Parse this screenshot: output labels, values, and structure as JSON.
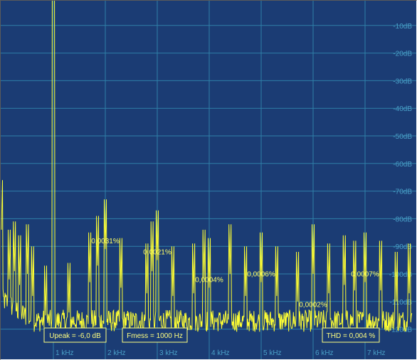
{
  "chart_data": {
    "type": "line",
    "title": "",
    "xlabel": "",
    "ylabel": "",
    "x_unit": "Hz",
    "y_unit": "dB",
    "xlim": [
      0,
      7900
    ],
    "ylim": [
      -130,
      0
    ],
    "grid": true,
    "colors": {
      "background": "#1b3c74",
      "grid": "#2f7fa8",
      "trace": "#ffff33",
      "tick_text": "#4aa0c8",
      "annotation": "#ffff66"
    },
    "y_ticks": [
      {
        "value": -10,
        "label": "-10dB"
      },
      {
        "value": -20,
        "label": "-20dB"
      },
      {
        "value": -30,
        "label": "-30dB"
      },
      {
        "value": -40,
        "label": "-40dB"
      },
      {
        "value": -50,
        "label": "-50dB"
      },
      {
        "value": -60,
        "label": "-60dB"
      },
      {
        "value": -70,
        "label": "-70dB"
      },
      {
        "value": -80,
        "label": "-80dB"
      },
      {
        "value": -90,
        "label": "-90dB"
      },
      {
        "value": -100,
        "label": "-100dB"
      },
      {
        "value": -110,
        "label": "-110dB"
      },
      {
        "value": -120,
        "label": "-120dB"
      }
    ],
    "x_ticks": [
      {
        "value": 1000,
        "label": "1 kHz"
      },
      {
        "value": 2000,
        "label": "2 kHz"
      },
      {
        "value": 3000,
        "label": "3 kHz"
      },
      {
        "value": 4000,
        "label": "4 kHz"
      },
      {
        "value": 5000,
        "label": "5 kHz"
      },
      {
        "value": 6000,
        "label": "6 kHz"
      },
      {
        "value": 7000,
        "label": "7 kHz"
      }
    ],
    "peaks": [
      {
        "x": 0,
        "y": -84
      },
      {
        "x": 150,
        "y": -102
      },
      {
        "x": 250,
        "y": -99
      },
      {
        "x": 350,
        "y": -104
      },
      {
        "x": 500,
        "y": -100
      },
      {
        "x": 600,
        "y": -108
      },
      {
        "x": 850,
        "y": -115
      },
      {
        "x": 1000,
        "y": -0.5
      },
      {
        "x": 1300,
        "y": -114
      },
      {
        "x": 1700,
        "y": -103
      },
      {
        "x": 1850,
        "y": -97
      },
      {
        "x": 2000,
        "y": -91
      },
      {
        "x": 2300,
        "y": -105
      },
      {
        "x": 2800,
        "y": -107
      },
      {
        "x": 2900,
        "y": -99
      },
      {
        "x": 3000,
        "y": -95
      },
      {
        "x": 3300,
        "y": -108
      },
      {
        "x": 3700,
        "y": -107
      },
      {
        "x": 3900,
        "y": -102
      },
      {
        "x": 4000,
        "y": -105
      },
      {
        "x": 4400,
        "y": -100
      },
      {
        "x": 4700,
        "y": -108
      },
      {
        "x": 5000,
        "y": -103
      },
      {
        "x": 5300,
        "y": -108
      },
      {
        "x": 5700,
        "y": -110
      },
      {
        "x": 6000,
        "y": -100
      },
      {
        "x": 6300,
        "y": -107
      },
      {
        "x": 6600,
        "y": -104
      },
      {
        "x": 6800,
        "y": -106
      },
      {
        "x": 7000,
        "y": -103
      },
      {
        "x": 7300,
        "y": -106
      },
      {
        "x": 7600,
        "y": -110
      },
      {
        "x": 7850,
        "y": -107
      }
    ],
    "noise_floor_db": -117,
    "annotations": [
      {
        "x": 2000,
        "y": -91,
        "text": "0,0031%"
      },
      {
        "x": 3000,
        "y": -95,
        "text": "0,0021%"
      },
      {
        "x": 4000,
        "y": -105,
        "text": "0,0004%"
      },
      {
        "x": 5000,
        "y": -103,
        "text": "0,0006%"
      },
      {
        "x": 6000,
        "y": -114,
        "text": "0,0002%"
      },
      {
        "x": 7000,
        "y": -103,
        "text": "0,0007%"
      }
    ],
    "info_boxes": [
      {
        "text": "Upeak = -6,0 dB"
      },
      {
        "text": "Fmess = 1000 Hz"
      },
      {
        "text": "THD = 0,004 %"
      }
    ]
  }
}
